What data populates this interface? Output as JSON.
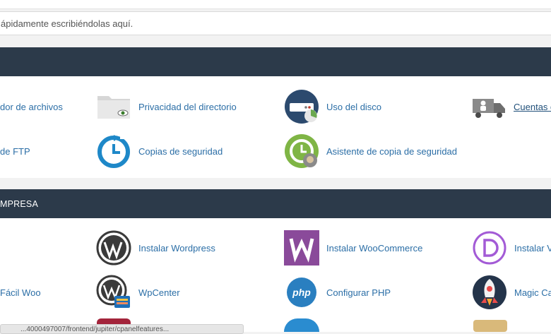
{
  "search": {
    "placeholder": "ápidamente escribiéndolas aquí."
  },
  "sections": {
    "files": {
      "title": "",
      "items": [
        {
          "label": "dor de archivos",
          "icon": "file-manager-icon"
        },
        {
          "label": "Privacidad del directorio",
          "icon": "folder-eye-icon"
        },
        {
          "label": "Uso del disco",
          "icon": "disk-usage-icon"
        },
        {
          "label": "Cuentas d",
          "icon": "delivery-truck-icon"
        },
        {
          "label": "de FTP",
          "icon": "ftp-icon"
        },
        {
          "label": "Copias de seguridad",
          "icon": "backup-clock-icon"
        },
        {
          "label": "Asistente de copia de seguridad",
          "icon": "backup-wizard-icon"
        }
      ]
    },
    "business": {
      "title": "MPRESA",
      "items": [
        {
          "label": "Instalar Wordpress",
          "icon": "wordpress-icon"
        },
        {
          "label": "Instalar WooCommerce",
          "icon": "woocommerce-icon"
        },
        {
          "label": "Instalar V",
          "icon": "divi-icon"
        },
        {
          "label": "Fácil Woo",
          "icon": ""
        },
        {
          "label": "WpCenter",
          "icon": "wpcenter-icon"
        },
        {
          "label": "Configurar PHP",
          "icon": "php-icon"
        },
        {
          "label": "Magic Ca",
          "icon": "rocket-icon"
        }
      ]
    }
  },
  "tooltip": {
    "text": "...4000497007/frontend/jupiter/cpanelfeatures..."
  },
  "colors": {
    "header_bg": "#2c3a4a",
    "link": "#2b6ea6",
    "page_bg": "#f2f2f2"
  }
}
